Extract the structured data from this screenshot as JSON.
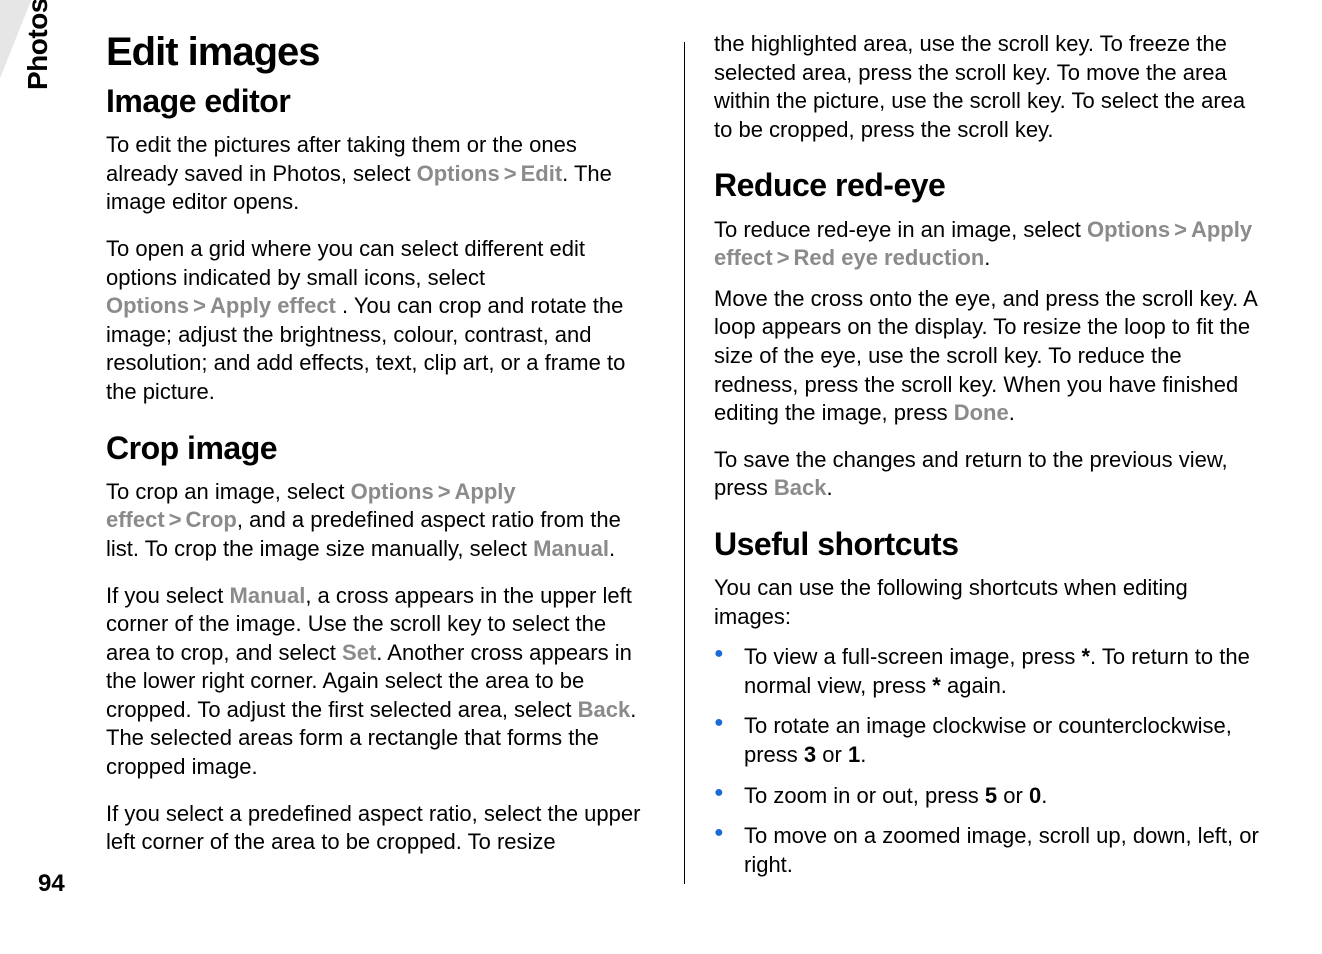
{
  "sideTab": "Photos",
  "pageNumber": "94",
  "left": {
    "h1": "Edit images",
    "h2a": "Image editor",
    "p1a": "To edit the pictures after taking them or the ones already saved in Photos, select ",
    "p1_key1": "Options",
    "p1_sep": ">",
    "p1_key2": "Edit",
    "p1b": ". The image editor opens.",
    "p2a": "To open a grid where you can select different edit options indicated by small icons, select ",
    "p2_key1": "Options",
    "p2_key2": "Apply effect",
    "p2b": " . You can crop and rotate the image; adjust the brightness, colour, contrast, and resolution; and add effects, text, clip art, or a frame to the picture.",
    "h2b": "Crop image",
    "p3a": "To crop an image, select ",
    "p3_key1": "Options",
    "p3_key2": "Apply effect",
    "p3_key3": "Crop",
    "p3b": ", and a predefined aspect ratio from the list. To crop the image size manually, select ",
    "p3_key4": "Manual",
    "p3c": ".",
    "p4a": "If you select ",
    "p4_key1": "Manual",
    "p4b": ", a cross appears in the upper left corner of the image. Use the scroll key to select the area to crop, and select ",
    "p4_key2": "Set",
    "p4c": ". Another cross appears in the lower right corner. Again select the area to be cropped. To adjust the first selected area, select ",
    "p4_key3": "Back",
    "p4d": ". The selected areas form a rectangle that forms the cropped image.",
    "p5": "If you select a predefined aspect ratio, select the upper left corner of the area to be cropped. To resize"
  },
  "right": {
    "p1": "the highlighted area, use the scroll key. To freeze the selected area, press the scroll key. To move the area within the picture, use the scroll key. To select the area to be cropped, press the scroll key.",
    "h2a": "Reduce red-eye",
    "p2a": "To reduce red-eye in an image, select ",
    "p2_key1": "Options",
    "p2_key2": "Apply effect",
    "p2_key3": "Red eye reduction",
    "p2b": ".",
    "p3a": "Move the cross onto the eye, and press the scroll key. A loop appears on the display. To resize the loop to fit the size of the eye, use the scroll key. To reduce the redness, press the scroll key. When you have finished editing the image, press ",
    "p3_key1": "Done",
    "p3b": ".",
    "p4a": "To save the changes and return to the previous view, press ",
    "p4_key1": "Back",
    "p4b": ".",
    "h2b": "Useful shortcuts",
    "p5": "You can use the following shortcuts when editing images:",
    "li1a": "To view a full-screen image, press ",
    "li1_key1": "*",
    "li1b": ". To return to the normal view, press ",
    "li1_key2": "*",
    "li1c": " again.",
    "li2a": "To rotate an image clockwise or counterclockwise, press ",
    "li2_key1": "3",
    "li2b": " or ",
    "li2_key2": "1",
    "li2c": ".",
    "li3a": "To zoom in or out, press ",
    "li3_key1": "5",
    "li3b": " or ",
    "li3_key2": "0",
    "li3c": ".",
    "li4": "To move on a zoomed image, scroll up, down, left, or right."
  }
}
